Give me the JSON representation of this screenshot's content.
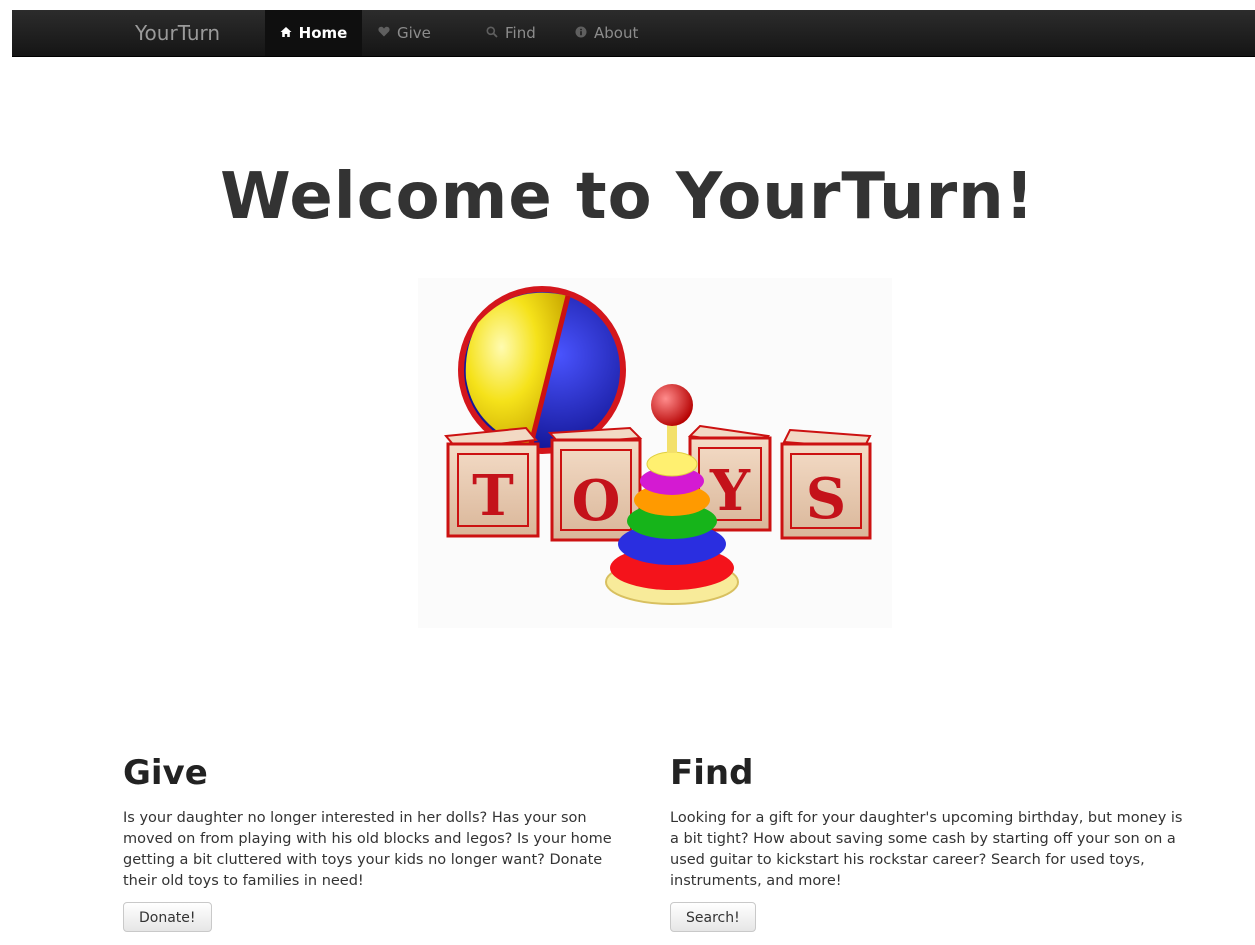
{
  "navbar": {
    "brand": "YourTurn",
    "items": [
      {
        "label": "Home",
        "icon": "home-icon",
        "active": true
      },
      {
        "label": "Give",
        "icon": "heart-icon",
        "active": false
      },
      {
        "label": "Find",
        "icon": "search-icon",
        "active": false
      },
      {
        "label": "About",
        "icon": "info-icon",
        "active": false
      }
    ]
  },
  "hero": {
    "title": "Welcome to YourTurn!",
    "image_letters": [
      "T",
      "O",
      "Y",
      "S"
    ]
  },
  "sections": {
    "give": {
      "heading": "Give",
      "body": "Is your daughter no longer interested in her dolls? Has your son moved on from playing with his old blocks and legos? Is your home getting a bit cluttered with toys your kids no longer want? Donate their old toys to families in need!",
      "button": "Donate!"
    },
    "find": {
      "heading": "Find",
      "body": "Looking for a gift for your daughter's upcoming birthday, but money is a bit tight? How about saving some cash by starting off your son on a used guitar to kickstart his rockstar career? Search for used toys, instruments, and more!",
      "button": "Search!"
    }
  }
}
